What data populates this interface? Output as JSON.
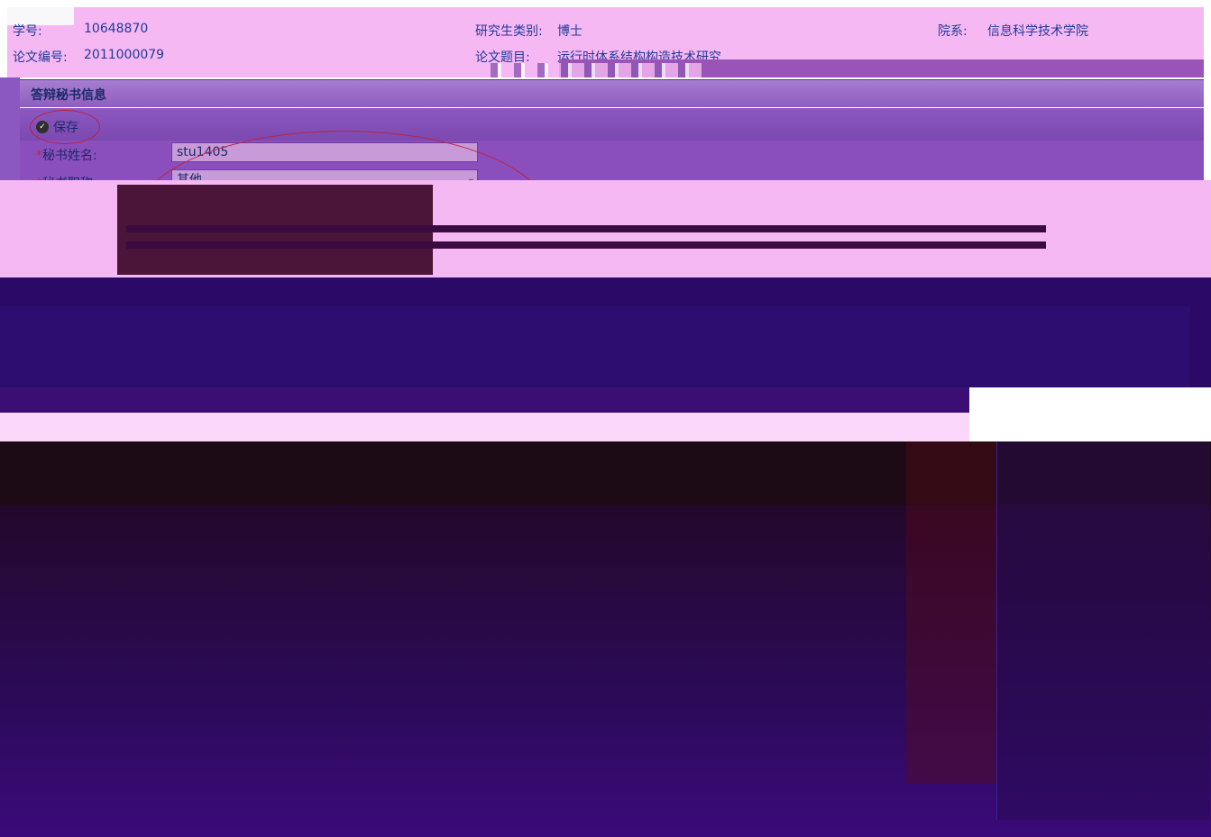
{
  "header": {
    "student_id_label": "学号:",
    "student_id": "10648870",
    "thesis_no_label": "论文编号:",
    "thesis_no": "2011000079",
    "category_label": "研究生类别:",
    "category": "博士",
    "title_label": "论文题目:",
    "title": "运行时体系结构构造技术研究",
    "dept_label": "院系:",
    "dept": "信息科学技术学院"
  },
  "panel": {
    "title": "答辩秘书信息",
    "save_label": "保存",
    "name_label": "秘书姓名:",
    "name_value": "stu1405",
    "rank_label": "秘书职称:",
    "rank_value": "其他",
    "required_mark": "*"
  },
  "colors": {
    "header_bg": "#f6b8f2",
    "panel_purple": "#8a4fbc",
    "dark_bg": "#1e0a1e"
  }
}
